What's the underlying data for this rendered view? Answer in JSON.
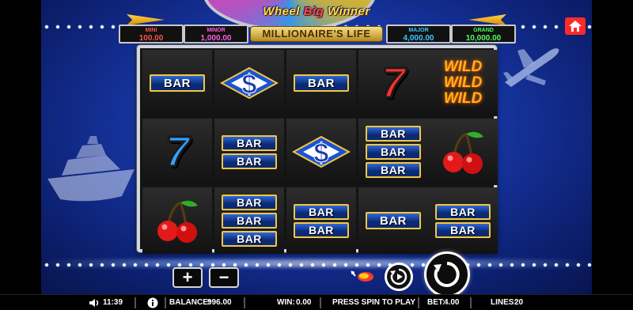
{
  "title": {
    "line1_a": "Wheel",
    "line1_b": "Big",
    "line1_c": "Winner",
    "line2": "MILLIONAIRE'S LIFE"
  },
  "jackpots": [
    {
      "label": "MINI",
      "value": "100.00",
      "color": "#ff5050"
    },
    {
      "label": "MINOR",
      "value": "1,000.00",
      "color": "#ff5ae6"
    },
    {
      "label": "MAJOR",
      "value": "4,000.00",
      "color": "#39c9ff"
    },
    {
      "label": "GRAND",
      "value": "10,000.00",
      "color": "#4cff5a"
    }
  ],
  "reels": [
    [
      "BAR",
      "SEVEN_BLUE",
      "CHERRY"
    ],
    [
      "DOLLAR",
      "DOUBLE_BAR",
      "TRIPLE_BAR"
    ],
    [
      "BAR",
      "DOLLAR",
      "DOUBLE_BAR"
    ],
    [
      "SEVEN_RED",
      "TRIPLE_BAR",
      "BAR"
    ],
    [
      "WILD",
      "CHERRY",
      "DOUBLE_BAR"
    ]
  ],
  "symbols": {
    "bar_text": "BAR",
    "wild_text": "WILD"
  },
  "controls": {
    "plus": "+",
    "minus": "−"
  },
  "status_bar": {
    "time": "11:39",
    "balance_label": "BALANCE:",
    "balance_value": "996.00",
    "win_label": "WIN:",
    "win_value": "0.00",
    "message": "PRESS SPIN TO PLAY",
    "bet_label": "BET:",
    "bet_value": "4.00",
    "lines_label": "LINES:",
    "lines_value": "20"
  },
  "icons": [
    "home-icon",
    "sound-icon",
    "info-icon",
    "autoplay-icon",
    "spin-icon",
    "chip-icon",
    "plane-icon",
    "yacht-icon"
  ]
}
